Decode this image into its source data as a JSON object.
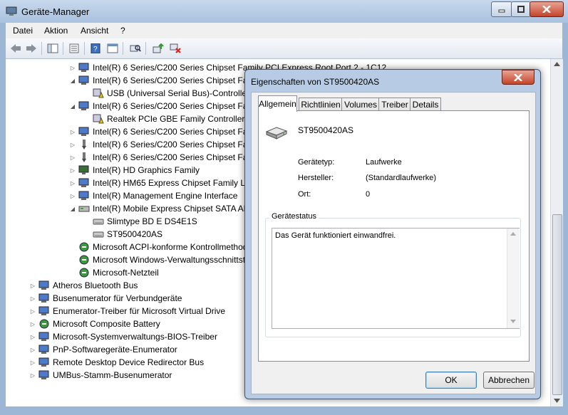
{
  "window": {
    "title": "Geräte-Manager"
  },
  "menu": [
    "Datei",
    "Aktion",
    "Ansicht",
    "?"
  ],
  "tree": {
    "rows": [
      {
        "text": "Intel(R) 6 Series/C200 Series Chipset Family PCI Express Root Port 2 - 1C12",
        "icon": "device-icon"
      },
      {
        "text": "Intel(R) 6 Series/C200 Series Chipset Fam",
        "icon": "device-icon"
      },
      {
        "text": "USB (Universal Serial Bus)-Controller",
        "icon": "warning-device-icon"
      },
      {
        "text": "Intel(R) 6 Series/C200 Series Chipset Fam",
        "icon": "device-icon"
      },
      {
        "text": "Realtek PCIe GBE Family Controller #",
        "icon": "warning-device-icon"
      },
      {
        "text": "Intel(R) 6 Series/C200 Series Chipset Fam",
        "icon": "device-icon"
      },
      {
        "text": "Intel(R) 6 Series/C200 Series Chipset Fam",
        "icon": "usb-icon"
      },
      {
        "text": "Intel(R) 6 Series/C200 Series Chipset Fam",
        "icon": "usb-icon"
      },
      {
        "text": "Intel(R) HD Graphics Family",
        "icon": "display-icon"
      },
      {
        "text": "Intel(R) HM65 Express Chipset Family LPC",
        "icon": "device-icon"
      },
      {
        "text": "Intel(R) Management Engine Interface",
        "icon": "device-icon"
      },
      {
        "text": "Intel(R) Mobile Express Chipset SATA AH",
        "icon": "storage-icon"
      },
      {
        "text": "Slimtype BD  E  DS4E1S",
        "icon": "drive-icon"
      },
      {
        "text": "ST9500420AS",
        "icon": "drive-icon"
      },
      {
        "text": "Microsoft ACPI-konforme Kontrollmethode",
        "icon": "battery-icon"
      },
      {
        "text": "Microsoft Windows-Verwaltungsschnittstelle",
        "icon": "battery-icon"
      },
      {
        "text": "Microsoft-Netzteil",
        "icon": "battery-icon"
      },
      {
        "text": "Atheros Bluetooth Bus",
        "icon": "device-icon"
      },
      {
        "text": "Busenumerator für Verbundgeräte",
        "icon": "device-icon"
      },
      {
        "text": "Enumerator-Treiber für Microsoft Virtual Drive",
        "icon": "device-icon"
      },
      {
        "text": "Microsoft Composite Battery",
        "icon": "battery-icon"
      },
      {
        "text": "Microsoft-Systemverwaltungs-BIOS-Treiber",
        "icon": "device-icon"
      },
      {
        "text": "PnP-Softwaregeräte-Enumerator",
        "icon": "device-icon"
      },
      {
        "text": "Remote Desktop Device Redirector Bus",
        "icon": "device-icon"
      },
      {
        "text": "UMBus-Stamm-Busenumerator",
        "icon": "device-icon"
      }
    ]
  },
  "dialog": {
    "title": "Eigenschaften von ST9500420AS",
    "tabs": [
      "Allgemein",
      "Richtlinien",
      "Volumes",
      "Treiber",
      "Details"
    ],
    "device_name": "ST9500420AS",
    "props": [
      {
        "label": "Gerätetyp:",
        "value": "Laufwerke"
      },
      {
        "label": "Hersteller:",
        "value": "(Standardlaufwerke)"
      },
      {
        "label": "Ort:",
        "value": "0"
      }
    ],
    "status_legend": "Gerätestatus",
    "status_text": "Das Gerät funktioniert einwandfrei.",
    "ok_label": "OK",
    "cancel_label": "Abbrechen"
  }
}
